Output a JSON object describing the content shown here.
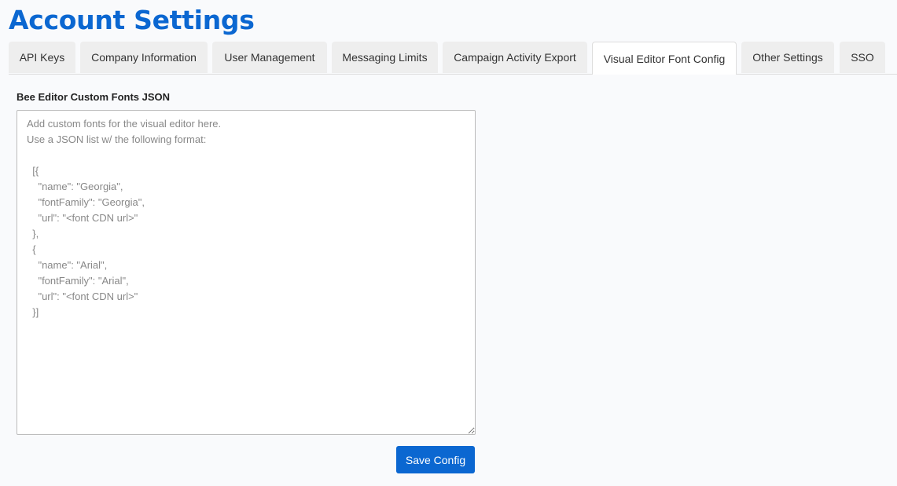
{
  "page": {
    "title": "Account Settings"
  },
  "tabs": [
    {
      "label": "API Keys",
      "active": false
    },
    {
      "label": "Company Information",
      "active": false
    },
    {
      "label": "User Management",
      "active": false
    },
    {
      "label": "Messaging Limits",
      "active": false
    },
    {
      "label": "Campaign Activity Export",
      "active": false
    },
    {
      "label": "Visual Editor Font Config",
      "active": true
    },
    {
      "label": "Other Settings",
      "active": false
    },
    {
      "label": "SSO",
      "active": false
    }
  ],
  "form": {
    "label": "Bee Editor Custom Fonts JSON",
    "value": "",
    "placeholder": "Add custom fonts for the visual editor here.\nUse a JSON list w/ the following format:\n\n  [{\n    \"name\": \"Georgia\",\n    \"fontFamily\": \"Georgia\",\n    \"url\": \"<font CDN url>\"\n  },\n  {\n    \"name\": \"Arial\",\n    \"fontFamily\": \"Arial\",\n    \"url\": \"<font CDN url>\"\n  }]",
    "save_label": "Save Config"
  },
  "colors": {
    "accent": "#0b67d1",
    "tab_background": "#eeeeee",
    "page_background": "#f9fafc"
  }
}
